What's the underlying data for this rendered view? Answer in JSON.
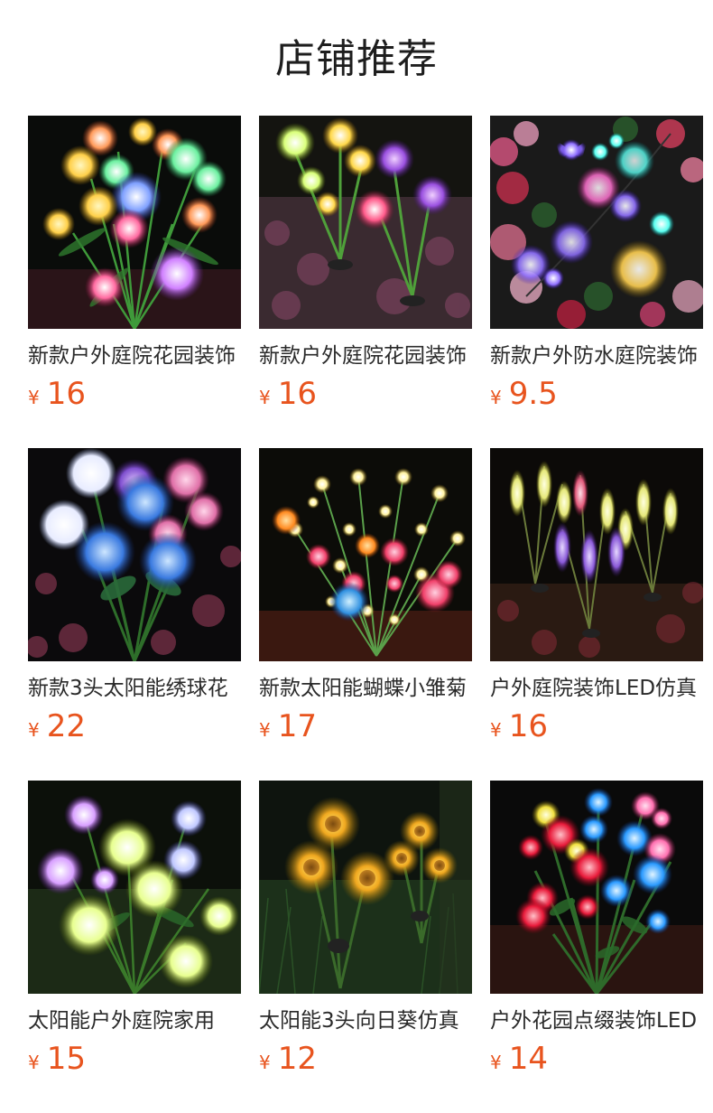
{
  "header": {
    "title": "店铺推荐"
  },
  "currency_symbol": "¥",
  "products": [
    {
      "name": "新款户外庭院花园装饰",
      "price": "16",
      "image_icon": "colorful-lily-lights-image"
    },
    {
      "name": "新款户外庭院花园装饰",
      "price": "16",
      "image_icon": "calla-lily-lights-image"
    },
    {
      "name": "新款户外防水庭院装饰",
      "price": "9.5",
      "image_icon": "butterfly-lights-image"
    },
    {
      "name": "新款3头太阳能绣球花",
      "price": "22",
      "image_icon": "hydrangea-lights-image"
    },
    {
      "name": "新款太阳能蝴蝶小雏菊",
      "price": "17",
      "image_icon": "butterfly-daisy-lights-image"
    },
    {
      "name": "户外庭院装饰LED仿真",
      "price": "16",
      "image_icon": "lavender-lights-image"
    },
    {
      "name": "太阳能户外庭院家用",
      "price": "15",
      "image_icon": "orchid-lights-image"
    },
    {
      "name": "太阳能3头向日葵仿真",
      "price": "12",
      "image_icon": "sunflower-lights-image"
    },
    {
      "name": "户外花园点缀装饰LED",
      "price": "14",
      "image_icon": "rose-lights-image"
    }
  ],
  "colors": {
    "price": "#e8541e",
    "title": "#1e1e1e",
    "name": "#2a2a2a"
  }
}
